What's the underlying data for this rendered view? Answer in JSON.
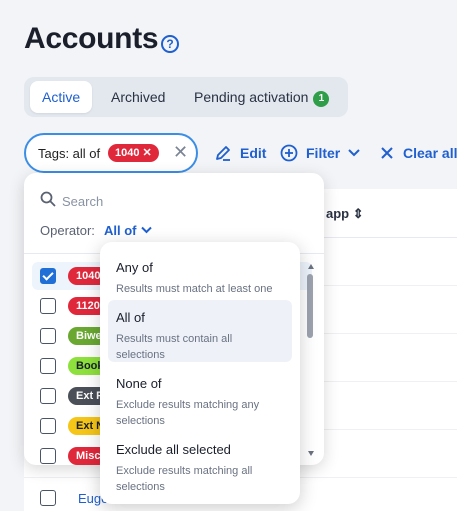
{
  "header": {
    "title": "Accounts",
    "help_icon": "help-circle-icon"
  },
  "tabs": [
    {
      "label": "Active",
      "active": true
    },
    {
      "label": "Archived",
      "active": false
    },
    {
      "label": "Pending activation",
      "active": false,
      "badge": "1"
    }
  ],
  "filter_chip": {
    "label": "Tags: all of",
    "tag": "1040",
    "tag_color": "#e0283b"
  },
  "toolbar": {
    "edit_label": "Edit",
    "filter_label": "Filter",
    "clear_all_label": "Clear all"
  },
  "table": {
    "visible_column": "app",
    "visible_row_name": "Euge"
  },
  "tag_dropdown": {
    "search_placeholder": "Search",
    "operator_label": "Operator:",
    "operator_value": "All of",
    "tags": [
      {
        "label": "1040",
        "checked": true,
        "bg": "#e0283b",
        "fg": "#ffffff"
      },
      {
        "label": "1120",
        "checked": false,
        "bg": "#e0283b",
        "fg": "#ffffff"
      },
      {
        "label": "Biwe",
        "checked": false,
        "bg": "#6aa832",
        "fg": "#ffffff"
      },
      {
        "label": "Book",
        "checked": false,
        "bg": "#8ee13c",
        "fg": "#1a1f2b"
      },
      {
        "label": "Ext F",
        "checked": false,
        "bg": "#4a4f58",
        "fg": "#ffffff"
      },
      {
        "label": "Ext N",
        "checked": false,
        "bg": "#f5c518",
        "fg": "#1a1f2b"
      },
      {
        "label": "Misc",
        "checked": false,
        "bg": "#e0283b",
        "fg": "#ffffff"
      }
    ]
  },
  "operator_menu": {
    "options": [
      {
        "title": "Any of",
        "desc": "Results must match at least one",
        "active": false
      },
      {
        "title": "All of",
        "desc": "Results must contain all selections",
        "active": true
      },
      {
        "title": "None of",
        "desc": "Exclude results matching any selections",
        "active": false
      },
      {
        "title": "Exclude all selected",
        "desc": "Exclude results matching all selections",
        "active": false
      }
    ]
  },
  "colors": {
    "accent": "#1f5fcf",
    "tag_red": "#e0283b",
    "badge_green": "#2e9e48"
  }
}
